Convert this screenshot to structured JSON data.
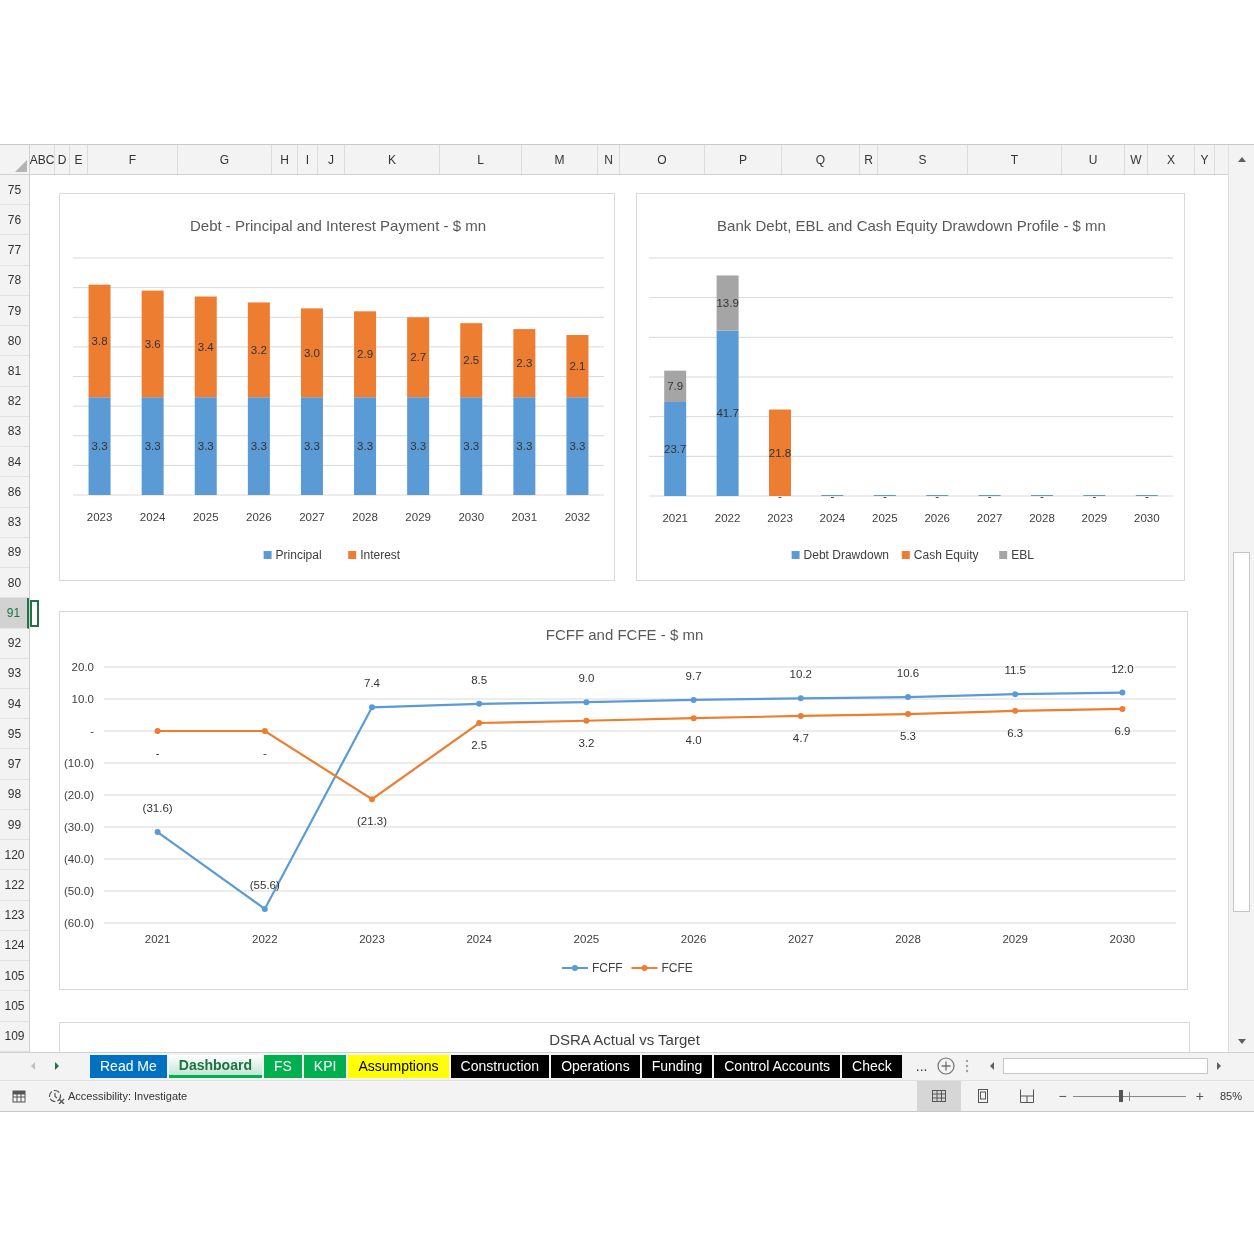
{
  "sheet": {
    "columns": [
      "ABC",
      "D",
      "E",
      "F",
      "G",
      "H",
      "I",
      "J",
      "K",
      "L",
      "M",
      "N",
      "O",
      "P",
      "Q",
      "R",
      "S",
      "T",
      "U",
      "W",
      "X",
      "Y"
    ],
    "rows": [
      {
        "label": "75",
        "selected": false
      },
      {
        "label": "76",
        "selected": false
      },
      {
        "label": "77",
        "selected": false
      },
      {
        "label": "78",
        "selected": false
      },
      {
        "label": "79",
        "selected": false
      },
      {
        "label": "80",
        "selected": false
      },
      {
        "label": "81",
        "selected": false
      },
      {
        "label": "82",
        "selected": false
      },
      {
        "label": "83",
        "selected": false
      },
      {
        "label": "84",
        "selected": false
      },
      {
        "label": "86",
        "selected": false
      },
      {
        "label": "83",
        "selected": false
      },
      {
        "label": "89",
        "selected": false
      },
      {
        "label": "80",
        "selected": false
      },
      {
        "label": "91",
        "selected": true
      },
      {
        "label": "92",
        "selected": false
      },
      {
        "label": "93",
        "selected": false
      },
      {
        "label": "94",
        "selected": false
      },
      {
        "label": "95",
        "selected": false
      },
      {
        "label": "97",
        "selected": false
      },
      {
        "label": "98",
        "selected": false
      },
      {
        "label": "99",
        "selected": false
      },
      {
        "label": "120",
        "selected": false
      },
      {
        "label": "122",
        "selected": false
      },
      {
        "label": "123",
        "selected": false
      },
      {
        "label": "124",
        "selected": false
      },
      {
        "label": "105",
        "selected": false
      },
      {
        "label": "105",
        "selected": false
      },
      {
        "label": "109",
        "selected": false
      }
    ],
    "charts": [
      {
        "chart_data": {
          "type": "bar",
          "title": "Debt - Principal and Interest Payment - $ mn",
          "categories": [
            "2023",
            "2024",
            "2025",
            "2026",
            "2027",
            "2028",
            "2029",
            "2030",
            "2031",
            "2032"
          ],
          "stacked": true,
          "grid": true,
          "legend": "bottom",
          "data_labels": true,
          "series": [
            {
              "name": "Principal",
              "color": "#5b9bd5",
              "values": [
                3.3,
                3.3,
                3.3,
                3.3,
                3.3,
                3.3,
                3.3,
                3.3,
                3.3,
                3.3
              ],
              "value_labels": [
                "3.3",
                "3.3",
                "3.3",
                "3.3",
                "3.3",
                "3.3",
                "3.3",
                "3.3",
                "3.3",
                "3.3"
              ]
            },
            {
              "name": "Interest",
              "color": "#ed7d31",
              "values": [
                3.8,
                3.6,
                3.4,
                3.2,
                3.0,
                2.9,
                2.7,
                2.5,
                2.3,
                2.1
              ],
              "value_labels": [
                "3.8",
                "3.6",
                "3.4",
                "3.2",
                "3.0",
                "2.9",
                "2.7",
                "2.5",
                "2.3",
                "2.1"
              ]
            }
          ]
        }
      },
      {
        "chart_data": {
          "type": "bar",
          "title": "Bank Debt, EBL and Cash Equity Drawdown Profile - $ mn",
          "categories": [
            "2021",
            "2022",
            "2023",
            "2024",
            "2025",
            "2026",
            "2027",
            "2028",
            "2029",
            "2030"
          ],
          "stacked": true,
          "grid": true,
          "legend": "bottom",
          "data_labels": true,
          "series": [
            {
              "name": "Debt Drawdown",
              "color": "#5b9bd5",
              "values": [
                23.7,
                41.7,
                0,
                0,
                0,
                0,
                0,
                0,
                0,
                0
              ],
              "value_labels": [
                "23.7",
                "41.7",
                "-",
                "-",
                "-",
                "-",
                "-",
                "-",
                "-",
                "-"
              ]
            },
            {
              "name": "Cash Equity",
              "color": "#ed7d31",
              "values": [
                null,
                null,
                21.8,
                null,
                null,
                null,
                null,
                null,
                null,
                null
              ],
              "value_labels": [
                null,
                null,
                "21.8",
                null,
                null,
                null,
                null,
                null,
                null,
                null
              ]
            },
            {
              "name": "EBL",
              "color": "#a5a5a5",
              "values": [
                7.9,
                13.9,
                null,
                null,
                null,
                null,
                null,
                null,
                null,
                null
              ],
              "value_labels": [
                "7.9",
                "13.9",
                null,
                null,
                null,
                null,
                null,
                null,
                null,
                null
              ]
            }
          ]
        }
      },
      {
        "chart_data": {
          "type": "line",
          "title": "FCFF and FCFE - $ mn",
          "categories": [
            "2021",
            "2022",
            "2023",
            "2024",
            "2025",
            "2026",
            "2027",
            "2028",
            "2029",
            "2030"
          ],
          "ylim": [
            -60,
            20
          ],
          "grid": true,
          "legend": "bottom",
          "data_labels": true,
          "yticks": [
            {
              "value": 20,
              "label": "20.0"
            },
            {
              "value": 10,
              "label": "10.0"
            },
            {
              "value": 0,
              "label": "-"
            },
            {
              "value": -10,
              "label": "(10.0)"
            },
            {
              "value": -20,
              "label": "(20.0)"
            },
            {
              "value": -30,
              "label": "(30.0)"
            },
            {
              "value": -40,
              "label": "(40.0)"
            },
            {
              "value": -50,
              "label": "(50.0)"
            },
            {
              "value": -60,
              "label": "(60.0)"
            }
          ],
          "series": [
            {
              "name": "FCFF",
              "color": "#5b9bd5",
              "marker": "circle",
              "values": [
                -31.6,
                -55.6,
                7.4,
                8.5,
                9.0,
                9.7,
                10.2,
                10.6,
                11.5,
                12.0
              ],
              "value_labels": [
                "(31.6)",
                "(55.6)",
                "7.4",
                "8.5",
                "9.0",
                "9.7",
                "10.2",
                "10.6",
                "11.5",
                "12.0"
              ]
            },
            {
              "name": "FCFE",
              "color": "#ed7d31",
              "marker": "circle",
              "values": [
                0,
                0,
                -21.3,
                2.5,
                3.2,
                4.0,
                4.7,
                5.3,
                6.3,
                6.9
              ],
              "value_labels": [
                "-",
                "-",
                "(21.3)",
                "2.5",
                "3.2",
                "4.0",
                "4.7",
                "5.3",
                "6.3",
                "6.9"
              ]
            }
          ]
        }
      }
    ],
    "partial_chart": {
      "title": "DSRA Actual vs Target"
    }
  },
  "tabs": [
    {
      "label": "Read Me",
      "color": "#0070c0",
      "selected": false
    },
    {
      "label": "Dashboard",
      "color": "#00b050",
      "selected": true
    },
    {
      "label": "FS",
      "color": "#00b050",
      "selected": false
    },
    {
      "label": "KPI",
      "color": "#00b050",
      "selected": false
    },
    {
      "label": "Assumptions",
      "color": "#ffff00",
      "selected": false
    },
    {
      "label": "Construction",
      "color": "#000000",
      "selected": false
    },
    {
      "label": "Operations",
      "color": "#000000",
      "selected": false
    },
    {
      "label": "Funding",
      "color": "#000000",
      "selected": false
    },
    {
      "label": "Control Accounts",
      "color": "#000000",
      "selected": false
    },
    {
      "label": "Check",
      "color": "#000000",
      "selected": false
    }
  ],
  "tab_overflow": "...",
  "status_bar": {
    "accessibility": "Accessibility: Investigate",
    "views": [
      {
        "kind": "normal",
        "selected": true
      },
      {
        "kind": "page_layout",
        "selected": false
      },
      {
        "kind": "page_break",
        "selected": false
      }
    ],
    "zoom": {
      "minus": "−",
      "plus": "+",
      "level": 0.43,
      "reading": "85%"
    }
  }
}
